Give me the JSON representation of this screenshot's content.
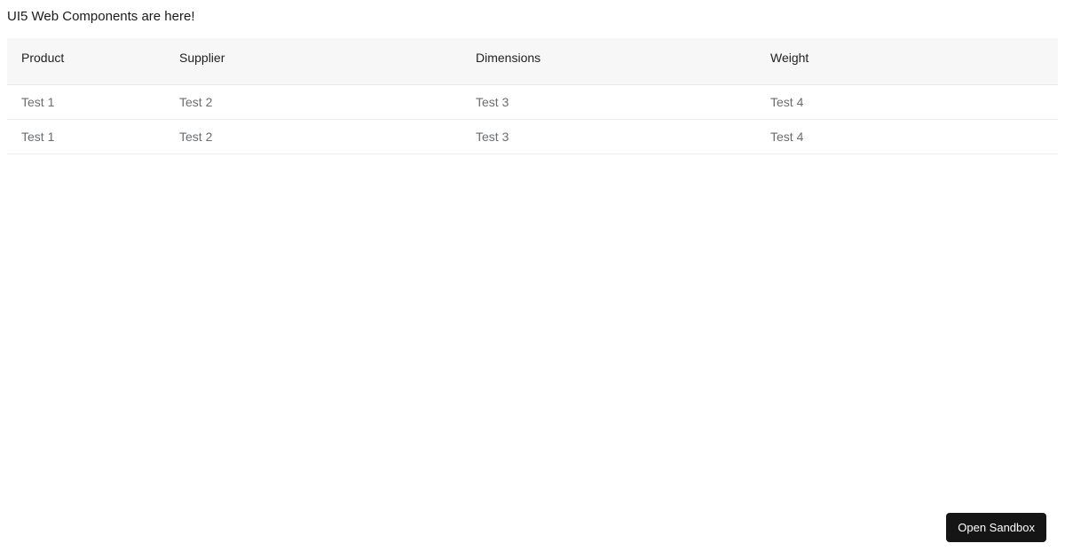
{
  "page": {
    "title": "UI5 Web Components are here!"
  },
  "table": {
    "columns": {
      "product": "Product",
      "supplier": "Supplier",
      "dimensions": "Dimensions",
      "weight": "Weight"
    },
    "rows": [
      {
        "product": "Test 1",
        "supplier": "Test 2",
        "dimensions": "Test 3",
        "weight": "Test 4"
      },
      {
        "product": "Test 1",
        "supplier": "Test 2",
        "dimensions": "Test 3",
        "weight": "Test 4"
      }
    ]
  },
  "buttons": {
    "open_sandbox": "Open Sandbox"
  }
}
